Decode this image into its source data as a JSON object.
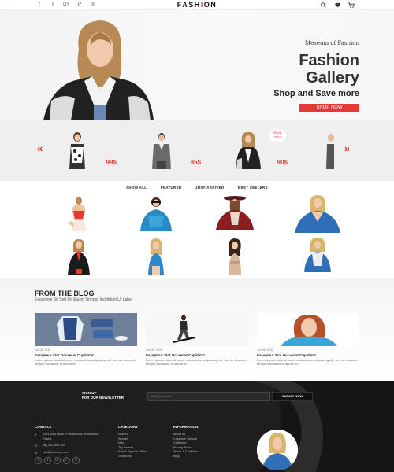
{
  "header": {
    "brand_left": "FASH",
    "brand_accent": "I",
    "brand_right": "ON",
    "social_icons": [
      "facebook-icon",
      "twitter-icon",
      "google-plus-icon",
      "pinterest-icon",
      "dribbble-icon"
    ],
    "social_glyphs": [
      "f",
      "t",
      "G+",
      "P",
      "◎"
    ],
    "tools": [
      "search-icon",
      "heart-icon",
      "cart-icon"
    ]
  },
  "hero": {
    "subtitle": "Meseum of Fashion",
    "title_line1": "Fashion",
    "title_line2": "Gallery",
    "tagline": "Shop and Save more",
    "button": "SHOP NOW"
  },
  "carousel": {
    "prev": "«",
    "next": "»",
    "items": [
      {
        "price": "99$"
      },
      {
        "price": "85$"
      },
      {
        "price": "90$",
        "badge_line1": "Save",
        "badge_line2": "22%"
      }
    ]
  },
  "filters": [
    "SHOW ALL",
    "FEATURED",
    "JUST ARRIVED",
    "BEST SEELERS"
  ],
  "blog": {
    "title": "FROM THE BLOG",
    "subtitle": "Excepteur Sit Sed Do Eiusm Tempor Incididunt Ut Labe.",
    "posts": [
      {
        "date": "Jan 08, 2016",
        "title": "Excepteur Sint Occaecat Cupidatat.",
        "body": "Lorem ipsum dolor sit amet, consectetur adipisicing elit, sed do eiusmod tempor incididunt ut labore et."
      },
      {
        "date": "Jan 08, 2016",
        "title": "Excepteur Sint Occaecat Cupidatat.",
        "body": "Lorem ipsum dolor sit amet, consectetur adipisicing elit, sed do eiusmod tempor incididunt ut labore et."
      },
      {
        "date": "Jan 08, 2016",
        "title": "Excepteur Sint Occaecat Cupidatat.",
        "body": "Lorem ipsum dolor sit amet, consectetur adipisicing elit, sed do eiusmod tempor incididunt ut labore et."
      }
    ]
  },
  "footer": {
    "newsletter_line1": "SIGN UP",
    "newsletter_line2": "FOR OUR NEWSLETTER",
    "email_placeholder": "Enter your email",
    "submit": "SUBMIT NOW",
    "contact": {
      "heading": "CONTACT",
      "address": "1201 park street, Fifth Avenue,Dharmandy, Dhaka.",
      "phone": "[88] 657 524 332",
      "email": "Info@fashshop.com"
    },
    "category": {
      "heading": "CATEGORY",
      "items": [
        "New In",
        "Women",
        "Man",
        "Top Brands",
        "Sale & Special Offers",
        "Lookbook"
      ]
    },
    "information": {
      "heading": "INFORMATION",
      "items": [
        "About us",
        "Customer Service",
        "Collection",
        "Privacy Policy",
        "Terms & Condition",
        "Blog"
      ]
    }
  },
  "colors": {
    "accent": "#e53935",
    "footer_bg": "#1e1e1e"
  }
}
